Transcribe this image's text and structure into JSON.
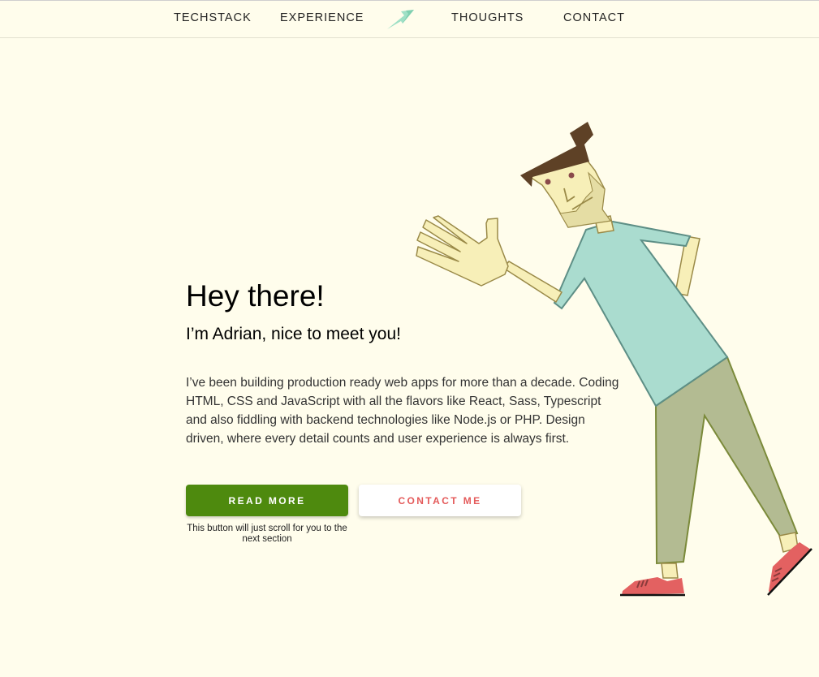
{
  "nav": {
    "items": [
      {
        "label": "TECHSTACK"
      },
      {
        "label": "EXPERIENCE"
      },
      {
        "label": "THOUGHTS"
      },
      {
        "label": "CONTACT"
      }
    ],
    "logo_icon": "lightning-bolt-icon"
  },
  "hero": {
    "title": "Hey there!",
    "subtitle": "I’m Adrian, nice to meet you!",
    "intro": "I’ve been building production ready web apps for more than a decade. Coding HTML, CSS and JavaScript with all the flavors like React, Sass, Typescript and also fiddling with backend technologies like Node.js or PHP. Design driven, where every detail counts and user experience is always first.",
    "illustration_icon": "waving-man-illustration"
  },
  "buttons": {
    "read_more": "READ MORE",
    "contact_me": "CONTACT ME",
    "hint": "This button will just scroll for you to the next section"
  },
  "colors": {
    "background": "#fffdec",
    "primary": "#4e8a0e",
    "accent": "#e45a5a",
    "shirt": "#aadccf",
    "pants": "#b3bb92",
    "skin": "#f7efb8"
  }
}
